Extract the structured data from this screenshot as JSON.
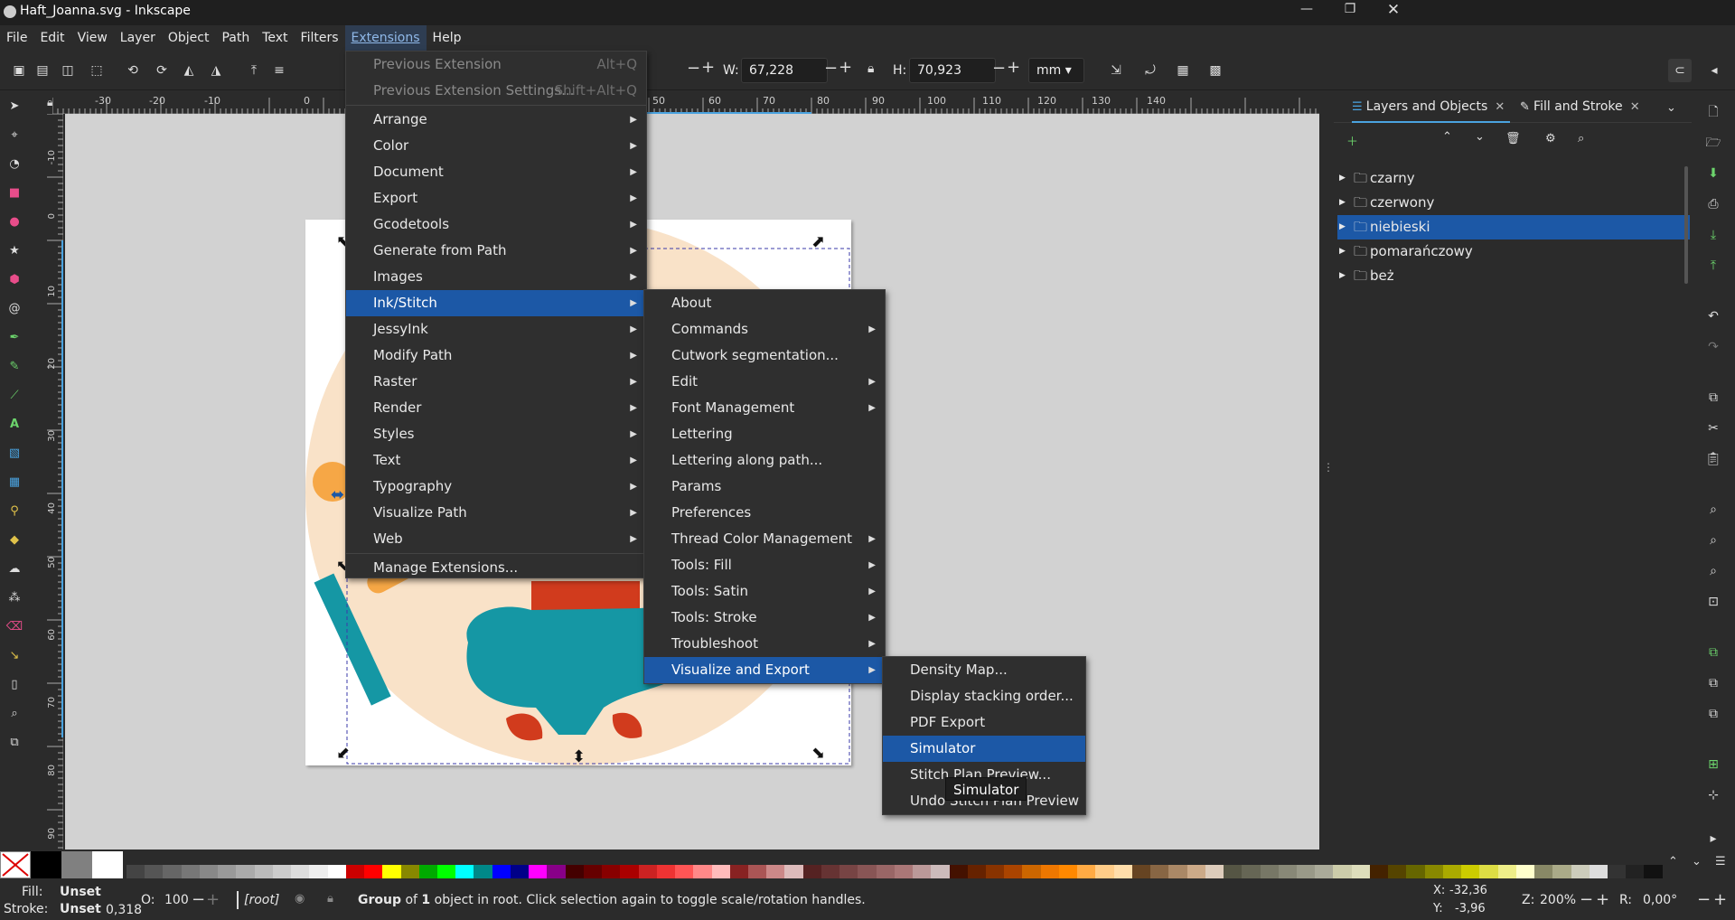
{
  "window": {
    "title": "Haft_Joanna.svg - Inkscape"
  },
  "menubar": {
    "items": [
      "File",
      "Edit",
      "View",
      "Layer",
      "Object",
      "Path",
      "Text",
      "Filters",
      "Extensions",
      "Help"
    ]
  },
  "toolbar": {
    "w_label": "W:",
    "w_value": "67,228",
    "h_label": "H:",
    "h_value": "70,923",
    "unit": "mm"
  },
  "extensions_menu": {
    "items": [
      {
        "label": "Previous Extension",
        "accel": "Alt+Q",
        "disabled": true
      },
      {
        "label": "Previous Extension Settings...",
        "accel": "Shift+Alt+Q",
        "disabled": true
      },
      {
        "label": "Arrange",
        "submenu": true
      },
      {
        "label": "Color",
        "submenu": true
      },
      {
        "label": "Document",
        "submenu": true
      },
      {
        "label": "Export",
        "submenu": true
      },
      {
        "label": "Gcodetools",
        "submenu": true
      },
      {
        "label": "Generate from Path",
        "submenu": true
      },
      {
        "label": "Images",
        "submenu": true
      },
      {
        "label": "Ink/Stitch",
        "submenu": true,
        "highlighted": true
      },
      {
        "label": "JessyInk",
        "submenu": true
      },
      {
        "label": "Modify Path",
        "submenu": true
      },
      {
        "label": "Raster",
        "submenu": true
      },
      {
        "label": "Render",
        "submenu": true
      },
      {
        "label": "Styles",
        "submenu": true
      },
      {
        "label": "Text",
        "submenu": true
      },
      {
        "label": "Typography",
        "submenu": true
      },
      {
        "label": "Visualize Path",
        "submenu": true
      },
      {
        "label": "Web",
        "submenu": true
      },
      {
        "label": "Manage Extensions..."
      }
    ]
  },
  "inkstitch_menu": {
    "items": [
      {
        "label": "About"
      },
      {
        "label": "Commands",
        "submenu": true
      },
      {
        "label": "Cutwork segmentation..."
      },
      {
        "label": "Edit",
        "submenu": true
      },
      {
        "label": "Font Management",
        "submenu": true
      },
      {
        "label": "Lettering"
      },
      {
        "label": "Lettering along path..."
      },
      {
        "label": "Params"
      },
      {
        "label": "Preferences"
      },
      {
        "label": "Thread Color Management",
        "submenu": true
      },
      {
        "label": "Tools: Fill",
        "submenu": true
      },
      {
        "label": "Tools: Satin",
        "submenu": true
      },
      {
        "label": "Tools: Stroke",
        "submenu": true
      },
      {
        "label": "Troubleshoot",
        "submenu": true
      },
      {
        "label": "Visualize and Export",
        "submenu": true,
        "highlighted": true
      }
    ]
  },
  "visualize_menu": {
    "items": [
      {
        "label": "Density Map..."
      },
      {
        "label": "Display stacking order..."
      },
      {
        "label": "PDF Export"
      },
      {
        "label": "Simulator",
        "highlighted": true
      },
      {
        "label": "Stitch Plan Preview..."
      },
      {
        "label": "Undo Stitch Plan Preview"
      }
    ],
    "tooltip": "Simulator"
  },
  "panel": {
    "tabs": [
      {
        "label": "Layers and Objects"
      },
      {
        "label": "Fill and Stroke"
      }
    ],
    "layers": [
      {
        "name": "czarny"
      },
      {
        "name": "czerwony"
      },
      {
        "name": "niebieski",
        "selected": true
      },
      {
        "name": "pomarańczowy"
      },
      {
        "name": "beż"
      }
    ]
  },
  "rulers": {
    "h_ticks": [
      "-30",
      "-20",
      "-10",
      "0",
      "50",
      "60",
      "70",
      "80",
      "90",
      "100",
      "110",
      "120",
      "130",
      "140"
    ],
    "v_ticks": [
      "-10",
      "0",
      "10",
      "20",
      "30",
      "40",
      "50",
      "60",
      "70",
      "80",
      "90"
    ]
  },
  "status": {
    "fill_label": "Fill:",
    "fill_value": "Unset",
    "stroke_label": "Stroke:",
    "stroke_value": "Unset",
    "stroke_width": "0,318",
    "opacity_label": "O:",
    "opacity_value": "100",
    "layer": "[root]",
    "message_bold": "Group",
    "message_rest": " of ",
    "message_num": "1",
    "message_tail": " object in root. Click selection again to toggle scale/rotation handles.",
    "x_label": "X:",
    "x_value": "-32,36",
    "y_label": "Y:",
    "y_value": "-3,96",
    "zoom_label": "Z:",
    "zoom_value": "200%",
    "rot_label": "R:",
    "rot_value": "0,00°"
  },
  "colors": {
    "accent": "#1c58a6",
    "peach": "#f9e2c8",
    "orange": "#f6a746",
    "teal": "#1597a4",
    "red": "#d13b1d"
  }
}
